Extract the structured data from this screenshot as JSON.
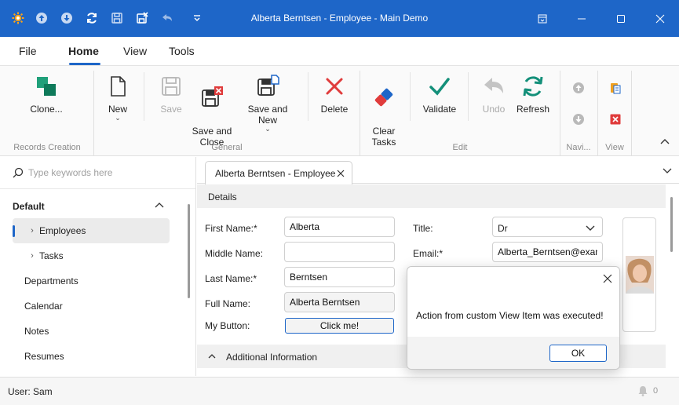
{
  "window": {
    "title": "Alberta Berntsen - Employee - Main Demo",
    "accent_color": "#1e66c8"
  },
  "quick_access": [
    {
      "icon": "app-logo-icon"
    },
    {
      "icon": "up-arrow-icon"
    },
    {
      "icon": "down-arrow-icon"
    },
    {
      "icon": "refresh-icon"
    },
    {
      "icon": "save-icon"
    },
    {
      "icon": "save-and-close-icon"
    },
    {
      "icon": "undo-icon"
    },
    {
      "icon": "customize-icon"
    }
  ],
  "ribbon_tabs": [
    "File",
    "Home",
    "View",
    "Tools"
  ],
  "ribbon": {
    "records_creation": {
      "label": "Records Creation",
      "clone": "Clone..."
    },
    "general": {
      "label": "General",
      "new": "New",
      "save": "Save",
      "save_close": "Save and\nClose",
      "save_new": "Save and New",
      "delete": "Delete"
    },
    "edit": {
      "label": "Edit",
      "clear_tasks": "Clear\nTasks",
      "validate": "Validate",
      "undo": "Undo",
      "refresh": "Refresh"
    },
    "navigation": {
      "label": "Navi..."
    },
    "view": {
      "label": "View"
    }
  },
  "sidebar": {
    "search_placeholder": "Type keywords here",
    "group": "Default",
    "items": [
      {
        "label": "Employees",
        "expandable": true,
        "selected": true
      },
      {
        "label": "Tasks",
        "expandable": true,
        "selected": false
      },
      {
        "label": "Departments",
        "expandable": false,
        "selected": false
      },
      {
        "label": "Calendar",
        "expandable": false,
        "selected": false
      },
      {
        "label": "Notes",
        "expandable": false,
        "selected": false
      },
      {
        "label": "Resumes",
        "expandable": false,
        "selected": false
      }
    ]
  },
  "document": {
    "tab_label": "Alberta Berntsen - Employee",
    "details_header": "Details",
    "fields": {
      "first_name_label": "First Name:*",
      "first_name": "Alberta",
      "middle_name_label": "Middle Name:",
      "middle_name": "",
      "last_name_label": "Last Name:*",
      "last_name": "Berntsen",
      "full_name_label": "Full Name:",
      "full_name": "Alberta Berntsen",
      "my_button_label": "My Button:",
      "my_button_text": "Click me!",
      "title_label": "Title:",
      "title": "Dr",
      "email_label": "Email:*",
      "email": "Alberta_Berntsen@exampl"
    },
    "additional_header": "Additional Information"
  },
  "dialog": {
    "message": "Action from custom View Item was executed!",
    "ok_label": "OK"
  },
  "status": {
    "user": "User: Sam",
    "notifications": "0"
  }
}
